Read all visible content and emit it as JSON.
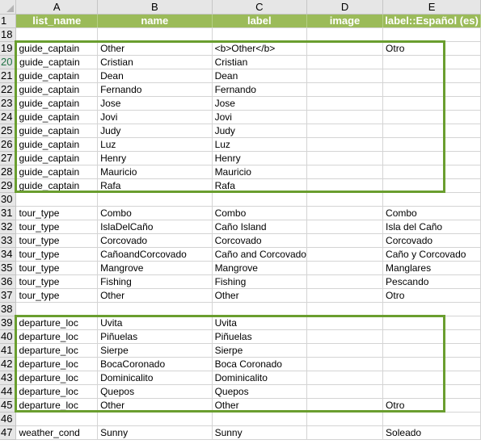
{
  "columns": [
    "A",
    "B",
    "C",
    "D",
    "E"
  ],
  "header_row": {
    "row_number": "1",
    "cells": [
      "list_name",
      "name",
      "label",
      "image",
      "label::Español (es)"
    ]
  },
  "active_row": "20",
  "rows": [
    {
      "n": "18",
      "cells": [
        "",
        "",
        "",
        "",
        ""
      ]
    },
    {
      "n": "19",
      "cells": [
        "guide_captain",
        "Other",
        "<b>Other</b>",
        "",
        "Otro"
      ]
    },
    {
      "n": "20",
      "cells": [
        "guide_captain",
        "Cristian",
        "Cristian",
        "",
        ""
      ]
    },
    {
      "n": "21",
      "cells": [
        "guide_captain",
        "Dean",
        "Dean",
        "",
        ""
      ]
    },
    {
      "n": "22",
      "cells": [
        "guide_captain",
        "Fernando",
        "Fernando",
        "",
        ""
      ]
    },
    {
      "n": "23",
      "cells": [
        "guide_captain",
        "Jose",
        "Jose",
        "",
        ""
      ]
    },
    {
      "n": "24",
      "cells": [
        "guide_captain",
        "Jovi",
        "Jovi",
        "",
        ""
      ]
    },
    {
      "n": "25",
      "cells": [
        "guide_captain",
        "Judy",
        "Judy",
        "",
        ""
      ]
    },
    {
      "n": "26",
      "cells": [
        "guide_captain",
        "Luz",
        "Luz",
        "",
        ""
      ]
    },
    {
      "n": "27",
      "cells": [
        "guide_captain",
        "Henry",
        "Henry",
        "",
        ""
      ]
    },
    {
      "n": "28",
      "cells": [
        "guide_captain",
        "Mauricio",
        "Mauricio",
        "",
        ""
      ]
    },
    {
      "n": "29",
      "cells": [
        "guide_captain",
        "Rafa",
        "Rafa",
        "",
        ""
      ]
    },
    {
      "n": "30",
      "cells": [
        "",
        "",
        "",
        "",
        ""
      ]
    },
    {
      "n": "31",
      "cells": [
        "tour_type",
        "Combo",
        "Combo",
        "",
        "Combo"
      ]
    },
    {
      "n": "32",
      "cells": [
        "tour_type",
        "IslaDelCaño",
        "Caño Island",
        "",
        "Isla del Caño"
      ]
    },
    {
      "n": "33",
      "cells": [
        "tour_type",
        "Corcovado",
        "Corcovado",
        "",
        "Corcovado"
      ]
    },
    {
      "n": "34",
      "cells": [
        "tour_type",
        "CañoandCorcovado",
        "Caño and Corcovado",
        "",
        "Caño y Corcovado"
      ]
    },
    {
      "n": "35",
      "cells": [
        "tour_type",
        "Mangrove",
        "Mangrove",
        "",
        "Manglares"
      ]
    },
    {
      "n": "36",
      "cells": [
        "tour_type",
        "Fishing",
        "Fishing",
        "",
        "Pescando"
      ]
    },
    {
      "n": "37",
      "cells": [
        "tour_type",
        "Other",
        "Other",
        "",
        "Otro"
      ]
    },
    {
      "n": "38",
      "cells": [
        "",
        "",
        "",
        "",
        ""
      ]
    },
    {
      "n": "39",
      "cells": [
        "departure_loc",
        "Uvita",
        "Uvita",
        "",
        ""
      ]
    },
    {
      "n": "40",
      "cells": [
        "departure_loc",
        "Piñuelas",
        "Piñuelas",
        "",
        ""
      ]
    },
    {
      "n": "41",
      "cells": [
        "departure_loc",
        "Sierpe",
        "Sierpe",
        "",
        ""
      ]
    },
    {
      "n": "42",
      "cells": [
        "departure_loc",
        "BocaCoronado",
        "Boca Coronado",
        "",
        ""
      ]
    },
    {
      "n": "43",
      "cells": [
        "departure_loc",
        "Dominicalito",
        "Dominicalito",
        "",
        ""
      ]
    },
    {
      "n": "44",
      "cells": [
        "departure_loc",
        "Quepos",
        "Quepos",
        "",
        ""
      ]
    },
    {
      "n": "45",
      "cells": [
        "departure_loc",
        "Other",
        "Other",
        "",
        "Otro"
      ]
    },
    {
      "n": "46",
      "cells": [
        "",
        "",
        "",
        "",
        ""
      ]
    },
    {
      "n": "47",
      "cells": [
        "weather_cond",
        "Sunny",
        "Sunny",
        "",
        "Soleado"
      ]
    }
  ],
  "highlight_boxes": [
    {
      "label": "guide_captain-group",
      "from_row": "19",
      "to_row": "29",
      "from_col": "A",
      "to_col": "E"
    },
    {
      "label": "departure_loc-group",
      "from_row": "39",
      "to_row": "45",
      "from_col": "A",
      "to_col": "E"
    }
  ],
  "colors": {
    "header_fill": "#9bbb59",
    "highlight_border": "#6a9e2f",
    "active_row_number": "#217346"
  }
}
